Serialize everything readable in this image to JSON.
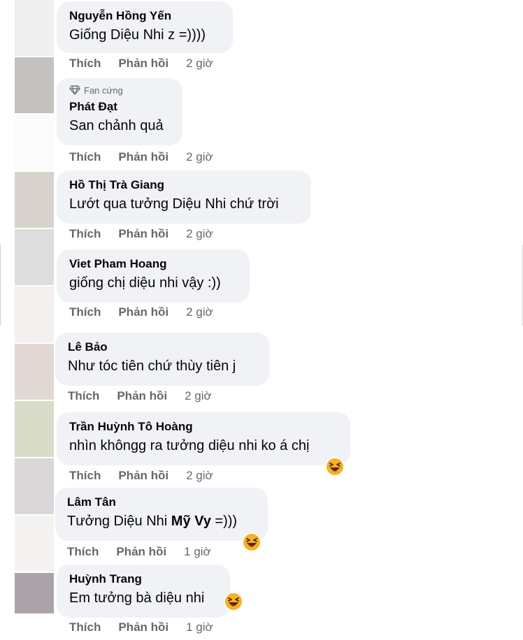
{
  "comments": [
    {
      "name": "Nguyễn Hồng Yến",
      "text": "Giống Diệu Nhi z =))))",
      "time": "2 giờ"
    },
    {
      "badge": "Fan cứng",
      "name": "Phát Đạt",
      "text": "San chảnh quả",
      "time": "2 giờ"
    },
    {
      "name": "Hồ Thị Trà Giang",
      "text": "Lướt qua tưởng Diệu Nhi chứ trời",
      "time": "2 giờ"
    },
    {
      "name": "Viet Pham Hoang",
      "text": "giống chị diệu nhi vậy :))",
      "time": "2 giờ"
    },
    {
      "name": "Lê Bảo",
      "text": "Như tóc tiên chứ thùy tiên j",
      "time": "2 giờ"
    },
    {
      "name": "Trần Huỳnh Tô Hoàng",
      "text": "nhìn khôngg ra tưởng diệu nhi ko á chị",
      "time": "2 giờ",
      "emoji": "laughing-emoji"
    },
    {
      "name": "Lâm Tân",
      "text_plain": "Tưởng Diệu Nhi ",
      "text_bold": "Mỹ Vy",
      "text_end": " =)))",
      "time": "1 giờ",
      "emoji": "laughing-emoji"
    },
    {
      "name": "Huỳnh Trang",
      "text": "Em tưởng bà diệu nhi",
      "time": "1 giờ",
      "emoji": "laughing-emoji"
    }
  ],
  "actions": {
    "like": "Thích",
    "reply": "Phản hồi"
  },
  "colors": {
    "bubble": "#f0f2f5",
    "name": "#050505",
    "meta": "#65676b",
    "emoji": "#f7b125"
  }
}
